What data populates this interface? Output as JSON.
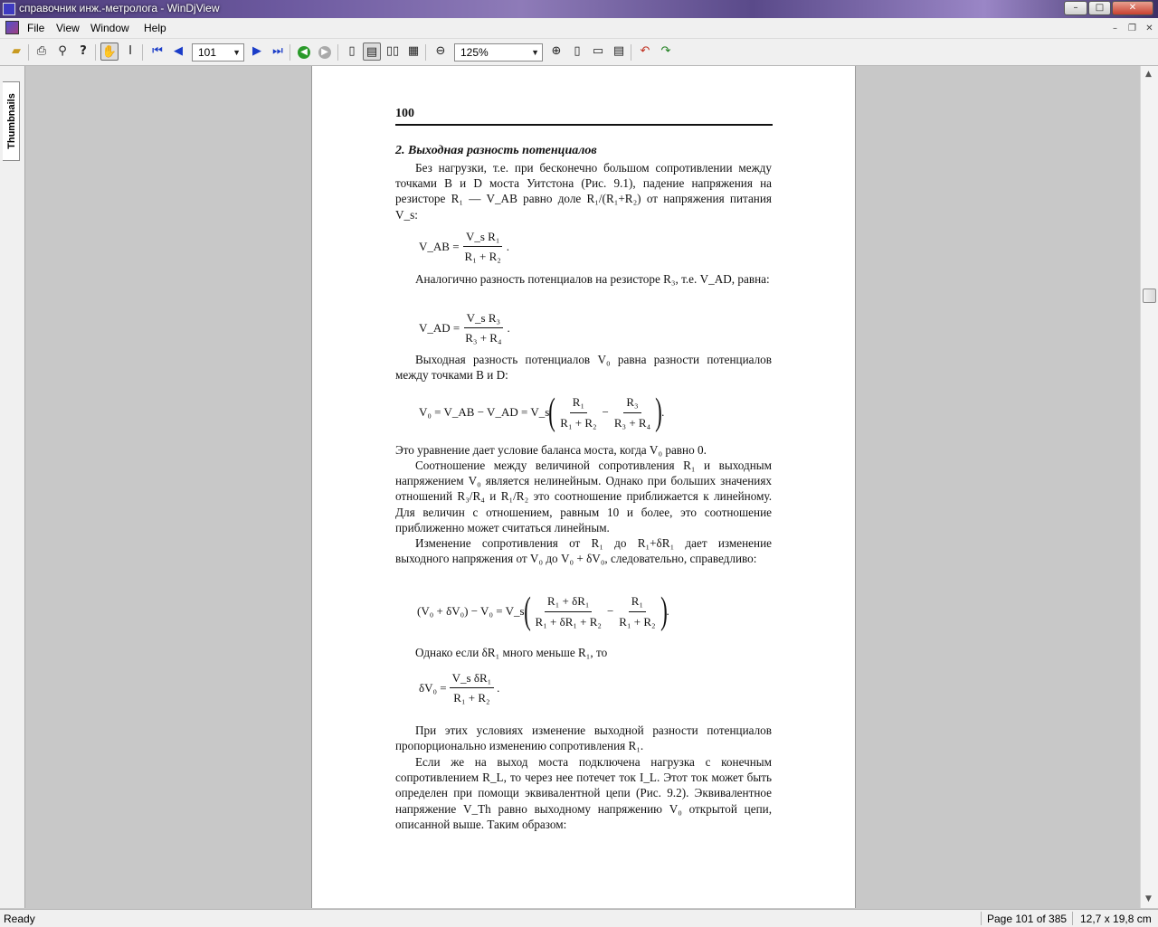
{
  "window": {
    "title": "справочник инж.-метролога - WinDjView",
    "controls": {
      "minimize": "–",
      "maximize": "□",
      "close": "✕"
    }
  },
  "menubar": {
    "items": [
      "File",
      "View",
      "Window",
      "Help"
    ],
    "mdi": {
      "minimize": "–",
      "restore": "❐",
      "close": "✕"
    }
  },
  "toolbar": {
    "page_number": "101",
    "zoom": "125%"
  },
  "sidebar": {
    "tab_label": "Thumbnails"
  },
  "document": {
    "page_number_printed": "100",
    "section_heading": "2. Выходная разность потенциалов",
    "p1": "Без нагрузки, т.е. при бесконечно большом сопротивлении между точками B и D моста Уитстона (Рис. 9.1), падение напряжения на резисторе R₁ — V_AB равно доле R₁/(R₁+R₂) от напряжения питания V_s:",
    "p2": "Аналогично разность потенциалов на резисторе R₃, т.е. V_AD, равна:",
    "p3": "Выходная разность потенциалов V₀ равна разности потенциалов между точками B и D:",
    "p4": "Это уравнение дает условие баланса моста, когда V₀ равно 0.",
    "p5": "Соотношение между величиной сопротивления R₁ и выходным напряжением V₀ является нелинейным. Однако при больших значениях отношений R₃/R₄ и R₁/R₂ это соотношение приближается к линейному. Для величин с отношением, равным 10 и более, это соотношение приближенно может считаться линейным.",
    "p6": "Изменение сопротивления от R₁ до R₁+δR₁ дает изменение выходного напряжения от V₀ до V₀ + δV₀, следовательно, справедливо:",
    "p7": "Однако если δR₁ много меньше R₁, то",
    "p8": "При этих условиях изменение выходной разности потенциалов пропорционально изменению сопротивления R₁.",
    "p9": "Если же на выход моста подключена нагрузка с конечным сопротивлением R_L, то через нее потечет ток I_L. Этот ток может быть определен при помощи эквивалентной цепи (Рис. 9.2). Эквивалентное напряжение V_Th равно выходному напряжению V₀ открытой цепи, описанной выше. Таким образом:",
    "f1": {
      "lhs": "V_AB =",
      "num": "V_s R₁",
      "den": "R₁ + R₂",
      "end": "."
    },
    "f2": {
      "lhs": "V_AD =",
      "num": "V_s R₃",
      "den": "R₃ + R₄",
      "end": "."
    },
    "f3": {
      "lhs": "V₀ = V_AB − V_AD = V_s",
      "n1": "R₁",
      "d1": "R₁ + R₂",
      "minus": "−",
      "n2": "R₃",
      "d2": "R₃ + R₄",
      "end": "."
    },
    "f4": {
      "lhs": "(V₀ + δV₀) − V₀ = V_s",
      "n1": "R₁ + δR₁",
      "d1": "R₁ + δR₁ + R₂",
      "minus": "−",
      "n2": "R₁",
      "d2": "R₁ + R₂",
      "end": "."
    },
    "f5": {
      "lhs": "δV₀ =",
      "num": "V_s δR₁",
      "den": "R₁ + R₂",
      "end": "."
    }
  },
  "status": {
    "ready": "Ready",
    "page": "Page 101 of 385",
    "size": "12,7 x 19,8 cm"
  }
}
